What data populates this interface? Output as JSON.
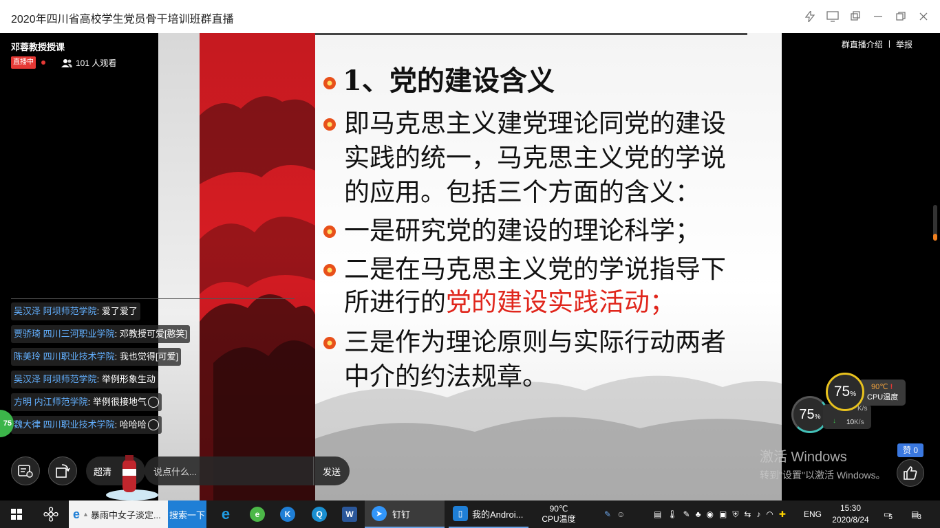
{
  "window": {
    "title": "2020年四川省高校学生党员骨干培训班群直播"
  },
  "live": {
    "title": "邓蓉教授授课",
    "badge": "直播中",
    "viewers": "101 人观看",
    "intro_link": "群直播介绍",
    "separator": "|",
    "report_link": "举报"
  },
  "slide": {
    "title": "1、党的建设含义",
    "lines": [
      "即马克思主义建党理论同党的建设",
      "实践的统一，马克思主义党的学说",
      "的应用。包括三个方面的含义：",
      " 一是研究党的建设的理论科学；",
      " 二是在马克思主义党的学说指导下",
      "所进行的",
      "党的建设实践活动；",
      "三是作为理论原则与实际行动两者",
      "中介的约法规章。"
    ]
  },
  "chat": [
    {
      "name": "吴汉泽 阿坝师范学院",
      "msg": ": 爱了爱了"
    },
    {
      "name": "贾骄琦 四川三河职业学院",
      "msg": ": 邓教授可爱[憨笑]"
    },
    {
      "name": "陈美玲 四川职业技术学院",
      "msg": ": 我也觉得[可爱]"
    },
    {
      "name": "吴汉泽 阿坝师范学院",
      "msg": ": 举例形象生动"
    },
    {
      "name": "方明 内江师范学院",
      "msg": ": 举例很接地气"
    },
    {
      "name": "魏大律 四川职业技术学院",
      "msg": ": 哈哈哈"
    }
  ],
  "controls": {
    "quality": "超清",
    "input_placeholder": "说点什么...",
    "send": "发送",
    "like_badge": "赞 0",
    "green_badge": "75"
  },
  "watermark": {
    "line1": "激活 Windows",
    "line2": "转到\"设置\"以激活 Windows。"
  },
  "system_monitor": {
    "gauge_big": "75",
    "gauge_small": "75",
    "percent": "%",
    "cpu_temp": "90℃",
    "cpu_label": "CPU温度",
    "net_down": "10",
    "net_unit": "K/s",
    "net_up_unit": "K/s"
  },
  "taskbar": {
    "search_text": "暴雨中女子淡定...",
    "search_button": "搜索一下",
    "dingtalk": "钉钉",
    "android": "我的Androi...",
    "cpu_temp": "90℃",
    "cpu_label": "CPU温度",
    "lang": "ENG",
    "time": "15:30",
    "date": "2020/8/24",
    "notif1": "5",
    "notif2": "3"
  },
  "colors": {
    "accent_red": "#e0261c",
    "chat_name": "#63b0ff",
    "live_red": "#e53935",
    "like_blue": "#3a78e0"
  }
}
